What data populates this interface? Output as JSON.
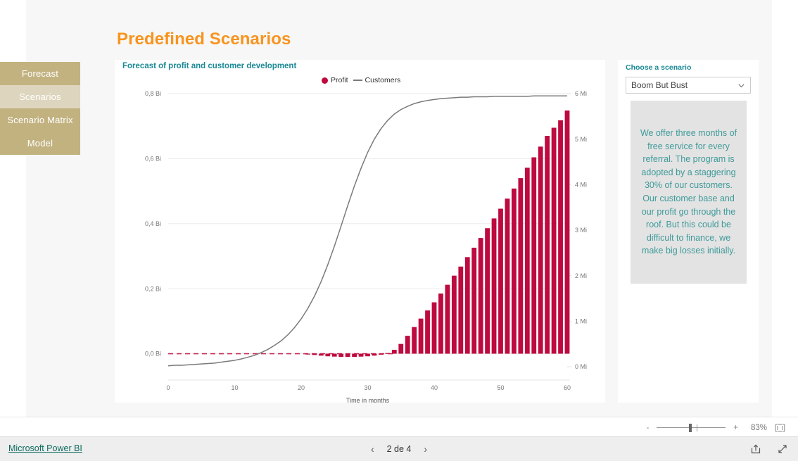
{
  "page": {
    "title": "Predefined Scenarios"
  },
  "sidebar": {
    "items": [
      {
        "label": "Forecast",
        "active": false
      },
      {
        "label": "Scenarios",
        "active": true
      },
      {
        "label": "Scenario Matrix",
        "active": false
      },
      {
        "label": "Model",
        "active": false
      }
    ]
  },
  "chart_card": {
    "title": "Forecast of profit and customer development"
  },
  "right_panel": {
    "label": "Choose a scenario",
    "selected": "Boom But Bust",
    "options": [
      "Boom But Bust"
    ],
    "description": "We offer three months of free service for every referral. The program is adopted by a staggering 30% of our customers. Our customer base and our profit go through the roof. But this could be difficult to finance, we make big losses initially."
  },
  "zoombar": {
    "minus": "-",
    "plus": "+",
    "percent": "83%",
    "fit_icon": "fit-to-page-icon"
  },
  "footer": {
    "brand": "Microsoft Power BI",
    "prev_icon": "chevron-left-icon",
    "next_icon": "chevron-right-icon",
    "page_indicator": "2 de 4",
    "share_icon": "share-icon",
    "fullscreen_icon": "fullscreen-icon"
  },
  "chart_data": {
    "type": "bar",
    "title": "Forecast of profit and customer development",
    "xlabel": "Time in months",
    "ylabel": "",
    "grid": true,
    "legend_position": "top-center",
    "x": [
      0,
      1,
      2,
      3,
      4,
      5,
      6,
      7,
      8,
      9,
      10,
      11,
      12,
      13,
      14,
      15,
      16,
      17,
      18,
      19,
      20,
      21,
      22,
      23,
      24,
      25,
      26,
      27,
      28,
      29,
      30,
      31,
      32,
      33,
      34,
      35,
      36,
      37,
      38,
      39,
      40,
      41,
      42,
      43,
      44,
      45,
      46,
      47,
      48,
      49,
      50,
      51,
      52,
      53,
      54,
      55,
      56,
      57,
      58,
      59,
      60
    ],
    "xticks": [
      0,
      10,
      20,
      30,
      40,
      50,
      60
    ],
    "left_axis": {
      "name": "Profit",
      "ticklabels": [
        "0,0 Bi",
        "0,2 Bi",
        "0,4 Bi",
        "0,6 Bi",
        "0,8 Bi"
      ],
      "tickvalues": [
        0,
        0.2,
        0.4,
        0.6,
        0.8
      ],
      "ylim": [
        -0.04,
        0.8
      ],
      "unit": "Bi"
    },
    "right_axis": {
      "name": "Customers",
      "ticklabels": [
        "0 Mi",
        "1 Mi",
        "2 Mi",
        "3 Mi",
        "4 Mi",
        "5 Mi",
        "6 Mi"
      ],
      "tickvalues": [
        0,
        1,
        2,
        3,
        4,
        5,
        6
      ],
      "ylim": [
        0,
        6
      ],
      "unit": "Mi"
    },
    "series": [
      {
        "name": "Profit",
        "type": "bar",
        "axis": "left",
        "color": "#be0a3e",
        "unit": "Bi",
        "values": [
          0,
          0,
          0,
          0,
          0,
          0,
          0,
          0,
          0,
          0,
          0,
          0,
          0,
          0,
          0,
          0,
          0,
          0,
          0,
          0,
          0,
          -0.002,
          -0.004,
          -0.006,
          -0.008,
          -0.009,
          -0.01,
          -0.01,
          -0.01,
          -0.009,
          -0.008,
          -0.006,
          -0.003,
          0.002,
          0.012,
          0.03,
          0.055,
          0.082,
          0.108,
          0.133,
          0.158,
          0.185,
          0.212,
          0.24,
          0.268,
          0.297,
          0.326,
          0.356,
          0.386,
          0.416,
          0.446,
          0.477,
          0.508,
          0.54,
          0.572,
          0.604,
          0.637,
          0.67,
          0.695,
          0.718,
          0.748
        ]
      },
      {
        "name": "Customers",
        "type": "line",
        "axis": "right",
        "color": "#7a7a7a",
        "unit": "Mi",
        "values": [
          0.02,
          0.03,
          0.03,
          0.04,
          0.05,
          0.06,
          0.07,
          0.08,
          0.1,
          0.12,
          0.14,
          0.17,
          0.21,
          0.25,
          0.31,
          0.38,
          0.47,
          0.57,
          0.7,
          0.86,
          1.05,
          1.28,
          1.55,
          1.87,
          2.24,
          2.65,
          3.09,
          3.54,
          3.97,
          4.36,
          4.71,
          5.0,
          5.23,
          5.41,
          5.55,
          5.65,
          5.72,
          5.78,
          5.82,
          5.85,
          5.87,
          5.89,
          5.9,
          5.91,
          5.92,
          5.92,
          5.93,
          5.93,
          5.93,
          5.94,
          5.94,
          5.94,
          5.94,
          5.94,
          5.94,
          5.95,
          5.95,
          5.95,
          5.95,
          5.95,
          5.95
        ]
      }
    ]
  }
}
